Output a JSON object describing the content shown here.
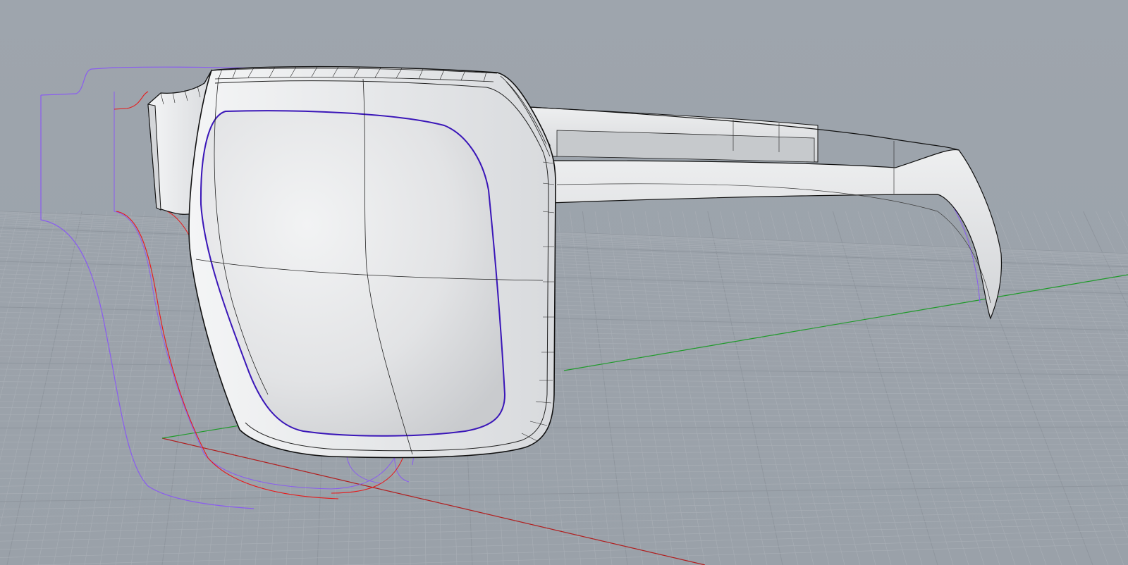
{
  "viewport": {
    "name": "perspective-viewport",
    "background_top": "#9ea5ad",
    "background_bottom": "#9aa1a9",
    "grid_minor_color": "#a9afb6",
    "grid_major_color": "#8f969e"
  },
  "axes": {
    "x_axis_color": "#b01e1e",
    "y_axis_color": "#1f9a2a"
  },
  "model": {
    "object": "sunglasses-frame",
    "surface_color": "#e6e7e9",
    "surface_shade": "#cfd1d4",
    "edge_color": "#111111",
    "isocurve_color": "#3a3a3a"
  },
  "curves": {
    "lens_outline_color": "#3a16b8",
    "selected_curve_color": "#e81818",
    "construction_curve_color": "#8a5cf0"
  }
}
